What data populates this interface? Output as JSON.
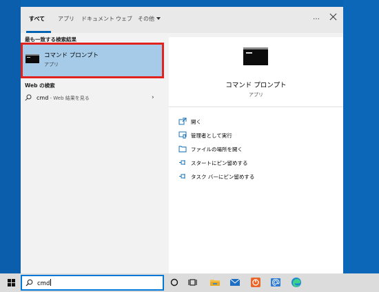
{
  "tabs": [
    {
      "label": "すべて"
    },
    {
      "label": "アプリ"
    },
    {
      "label": "ドキュメント"
    },
    {
      "label": "ウェブ"
    },
    {
      "label": "その他"
    }
  ],
  "top_bar": {
    "more_label": "…"
  },
  "best_match": {
    "section_title": "最も一致する検索結果",
    "title": "コマンド プロンプト",
    "subtitle": "アプリ"
  },
  "web_search": {
    "section_title": "Web の検索",
    "query": "cmd",
    "suffix": " - Web 結果を見る"
  },
  "detail": {
    "title": "コマンド プロンプト",
    "subtitle": "アプリ",
    "actions": [
      {
        "label": "開く",
        "icon": "open-icon"
      },
      {
        "label": "管理者として実行",
        "icon": "run-as-admin-icon"
      },
      {
        "label": "ファイルの場所を開く",
        "icon": "folder-icon"
      },
      {
        "label": "スタートにピン留めする",
        "icon": "pin-icon"
      },
      {
        "label": "タスク バーにピン留めする",
        "icon": "pin-icon"
      }
    ]
  },
  "taskbar": {
    "search_value": "cmd",
    "icons": [
      "windows-icon",
      "cortana-icon",
      "task-view-icon",
      "file-explorer-icon",
      "mail-icon",
      "app-icon",
      "mail-at-icon",
      "edge-icon"
    ]
  },
  "colors": {
    "highlight": "#a5cbe9",
    "red_frame": "#e0231f",
    "accent": "#0078d7",
    "desktop": "#0a64b4"
  }
}
